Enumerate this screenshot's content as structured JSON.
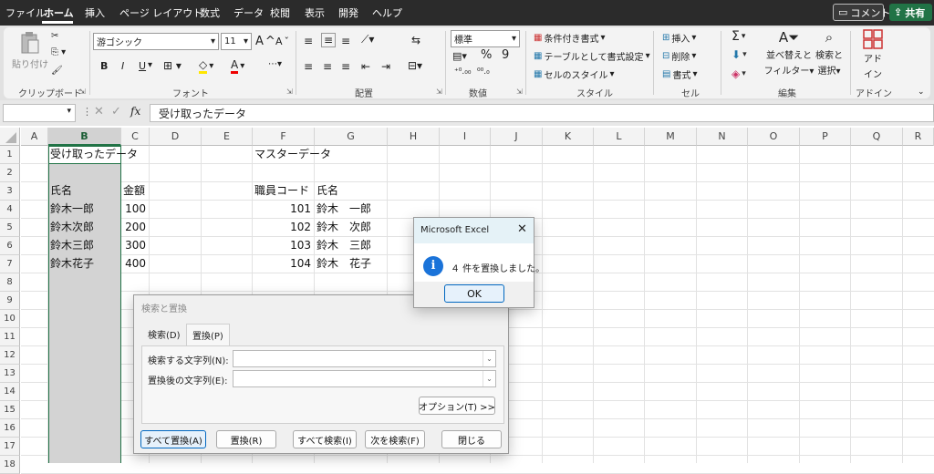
{
  "tabs": [
    "ファイル",
    "ホーム",
    "挿入",
    "ページ レイアウト",
    "数式",
    "データ",
    "校閲",
    "表示",
    "開発",
    "ヘルプ"
  ],
  "active_tab": "ホーム",
  "comment_button": "コメント",
  "share_button": "共有",
  "ribbon": {
    "clipboard": {
      "paste": "貼り付け",
      "label": "クリップボード"
    },
    "font": {
      "name": "游ゴシック",
      "size": "11",
      "bold": "B",
      "italic": "I",
      "underline": "U",
      "grow": "A",
      "shrink": "A",
      "label": "フォント"
    },
    "alignment": {
      "label": "配置"
    },
    "number": {
      "format": "標準",
      "label": "数値"
    },
    "styles": {
      "cond": "条件付き書式",
      "table": "テーブルとして書式設定",
      "cell": "セルのスタイル",
      "label": "スタイル"
    },
    "cells": {
      "insert": "挿入",
      "delete": "削除",
      "format": "書式",
      "label": "セル"
    },
    "editing": {
      "sum": "Σ",
      "sort": "並べ替えと",
      "sort2": "フィルター",
      "find": "検索と",
      "find2": "選択",
      "label": "編集"
    },
    "addins": {
      "name": "アド",
      "name2": "イン",
      "label": "アドイン"
    }
  },
  "formula_bar": {
    "fx": "fx",
    "content": "受け取ったデータ"
  },
  "columns": [
    "A",
    "B",
    "C",
    "D",
    "E",
    "F",
    "G",
    "H",
    "I",
    "J",
    "K",
    "L",
    "M",
    "N",
    "O",
    "P",
    "Q",
    "R"
  ],
  "rows": [
    "1",
    "2",
    "3",
    "4",
    "5",
    "6",
    "7",
    "8",
    "9",
    "10",
    "11",
    "12",
    "13",
    "14",
    "15",
    "16",
    "17",
    "18"
  ],
  "cells": {
    "B1": "受け取ったデータ",
    "F1": "マスターデータ",
    "B3": "氏名",
    "C3": "金額",
    "F3": "職員コード",
    "G3": "氏名",
    "B4": "鈴木一郎",
    "C4": "100",
    "F4": "101",
    "G4": "鈴木　一郎",
    "B5": "鈴木次郎",
    "C5": "200",
    "F5": "102",
    "G5": "鈴木　次郎",
    "B6": "鈴木三郎",
    "C6": "300",
    "F6": "103",
    "G6": "鈴木　三郎",
    "B7": "鈴木花子",
    "C7": "400",
    "F7": "104",
    "G7": "鈴木　花子"
  },
  "find_dialog": {
    "title": "検索と置換",
    "tab_find": "検索(D)",
    "tab_replace": "置換(P)",
    "find_label": "検索する文字列(N):",
    "find_value": "",
    "replace_label": "置換後の文字列(E):",
    "replace_value": "",
    "options": "オプション(T) >>",
    "replace_all": "すべて置換(A)",
    "replace": "置換(R)",
    "find_all": "すべて検索(I)",
    "find_next": "次を検索(F)",
    "close": "閉じる"
  },
  "msgbox": {
    "title": "Microsoft Excel",
    "message": "４ 件を置換しました。",
    "ok": "OK",
    "icon": "info-icon"
  },
  "colors": {
    "accent": "#217346",
    "tabbar": "#2b2b2b",
    "info": "#1a73d9"
  }
}
